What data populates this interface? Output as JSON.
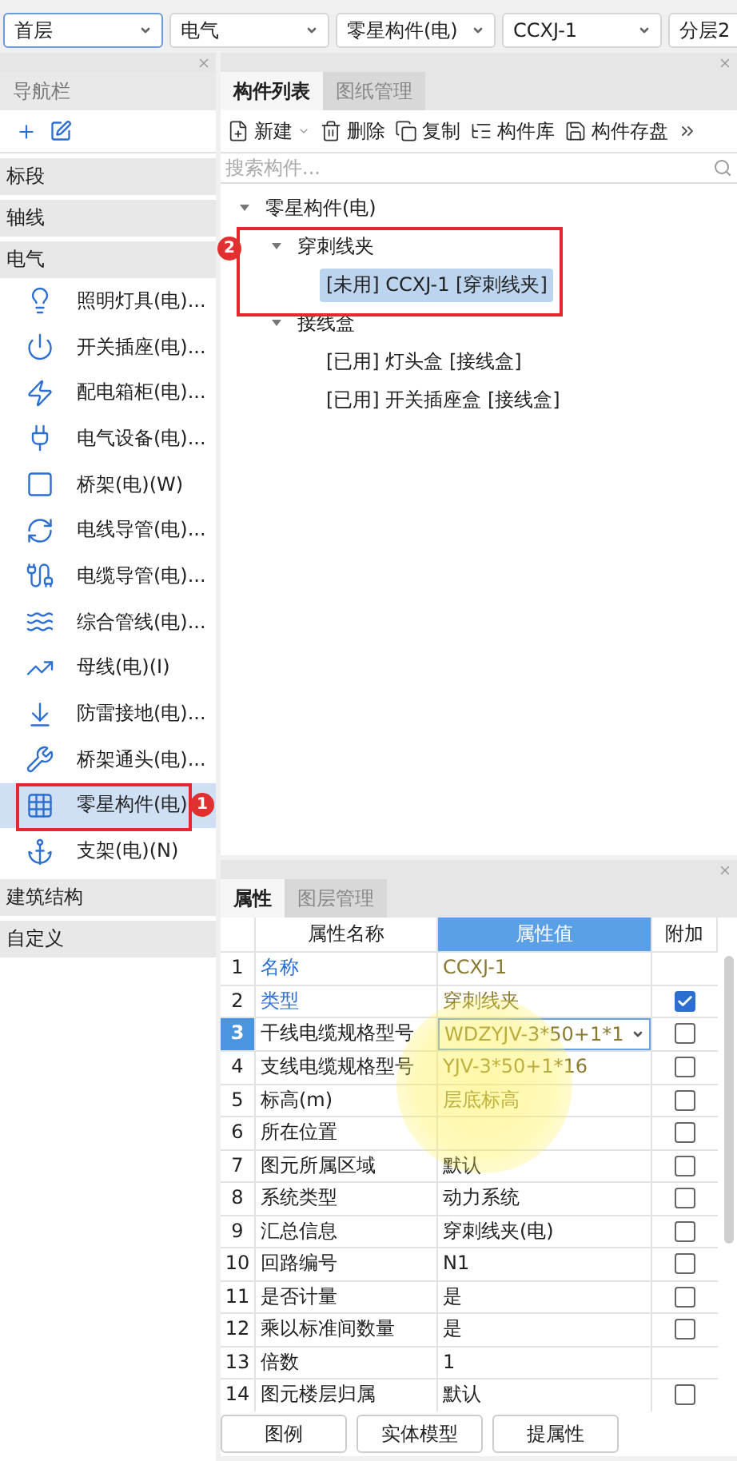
{
  "selectors": [
    {
      "value": "首层",
      "focused": true
    },
    {
      "value": "电气",
      "focused": false
    },
    {
      "value": "零星构件(电)",
      "focused": false
    },
    {
      "value": "CCXJ-1",
      "focused": false
    },
    {
      "value": "分层2",
      "focused": false
    }
  ],
  "nav": {
    "title": "导航栏",
    "groups": [
      {
        "label": "标段"
      },
      {
        "label": "轴线"
      },
      {
        "label": "电气",
        "items": [
          {
            "label": "照明灯具(电)...",
            "selected": false
          },
          {
            "label": "开关插座(电)...",
            "selected": false
          },
          {
            "label": "配电箱柜(电)...",
            "selected": false
          },
          {
            "label": "电气设备(电)...",
            "selected": false
          },
          {
            "label": "桥架(电)(W)",
            "selected": false
          },
          {
            "label": "电线导管(电)...",
            "selected": false
          },
          {
            "label": "电缆导管(电)...",
            "selected": false
          },
          {
            "label": "综合管线(电)...",
            "selected": false
          },
          {
            "label": "母线(电)(I)",
            "selected": false
          },
          {
            "label": "防雷接地(电)...",
            "selected": false
          },
          {
            "label": "桥架通头(电)...",
            "selected": false
          },
          {
            "label": "零星构件(电)",
            "selected": true,
            "callout": "1"
          },
          {
            "label": "支架(电)(N)",
            "selected": false
          }
        ]
      },
      {
        "label": "建筑结构"
      },
      {
        "label": "自定义"
      }
    ]
  },
  "component_panel": {
    "tabs": [
      {
        "label": "构件列表",
        "selected": true
      },
      {
        "label": "图纸管理",
        "selected": false
      }
    ],
    "toolbar": [
      {
        "label": "新建",
        "kind": "new"
      },
      {
        "label": "删除",
        "kind": "delete"
      },
      {
        "label": "复制",
        "kind": "copy"
      },
      {
        "label": "构件库",
        "kind": "library"
      },
      {
        "label": "构件存盘",
        "kind": "save"
      }
    ],
    "search": {
      "placeholder": "搜索构件..."
    },
    "tree": [
      {
        "label": "零星构件(电)",
        "expanded": true,
        "selected": false,
        "children": [
          {
            "label": "穿刺线夹",
            "expanded": true,
            "selected": false,
            "callout": "2",
            "children": [
              {
                "label": "[未用] CCXJ-1 [穿刺线夹]",
                "selected": true
              }
            ]
          },
          {
            "label": "接线盒",
            "expanded": true,
            "selected": false,
            "children": [
              {
                "label": "[已用] 灯头盒 [接线盒]",
                "selected": false
              },
              {
                "label": "[已用] 开关插座盒 [接线盒]",
                "selected": false
              }
            ]
          }
        ]
      }
    ]
  },
  "property_panel": {
    "tabs": [
      {
        "label": "属性",
        "selected": true
      },
      {
        "label": "图层管理",
        "selected": false
      }
    ],
    "columns": [
      "属性名称",
      "属性值",
      "附加"
    ],
    "rows": [
      {
        "no": "1",
        "name": "名称",
        "value": "CCXJ-1",
        "linked": true,
        "selected": false
      },
      {
        "no": "2",
        "name": "类型",
        "value": "穿刺线夹",
        "linked": true,
        "selected": false,
        "checked": true
      },
      {
        "no": "3",
        "name": "干线电缆规格型号",
        "value": "WDZYJV-3*50+1*1",
        "linked": false,
        "selected": true,
        "editing": true,
        "checked": false
      },
      {
        "no": "4",
        "name": "支线电缆规格型号",
        "value": "YJV-3*50+1*16",
        "linked": false,
        "selected": false,
        "checked": false
      },
      {
        "no": "5",
        "name": "标高(m)",
        "value": "层底标高",
        "linked": false,
        "selected": false,
        "checked": false
      },
      {
        "no": "6",
        "name": "所在位置",
        "linked": false,
        "selected": false,
        "checked": false
      },
      {
        "no": "7",
        "name": "图元所属区域",
        "value": "默认",
        "linked": false,
        "selected": false,
        "checked": false
      },
      {
        "no": "8",
        "name": "系统类型",
        "value": "动力系统",
        "linked": false,
        "selected": false,
        "checked": false
      },
      {
        "no": "9",
        "name": "汇总信息",
        "value": "穿刺线夹(电)",
        "linked": false,
        "selected": false,
        "checked": false
      },
      {
        "no": "10",
        "name": "回路编号",
        "value": "N1",
        "linked": false,
        "selected": false,
        "checked": false
      },
      {
        "no": "11",
        "name": "是否计量",
        "value": "是",
        "linked": false,
        "selected": false,
        "checked": false
      },
      {
        "no": "12",
        "name": "乘以标准间数量",
        "value": "是",
        "linked": false,
        "selected": false,
        "checked": false
      },
      {
        "no": "13",
        "name": "倍数",
        "value": "1",
        "linked": false,
        "selected": false
      },
      {
        "no": "14",
        "name": "图元楼层归属",
        "value": "默认",
        "linked": false,
        "selected": false,
        "checked": false
      }
    ],
    "buttons": [
      "图例",
      "实体模型",
      "提属性"
    ]
  }
}
